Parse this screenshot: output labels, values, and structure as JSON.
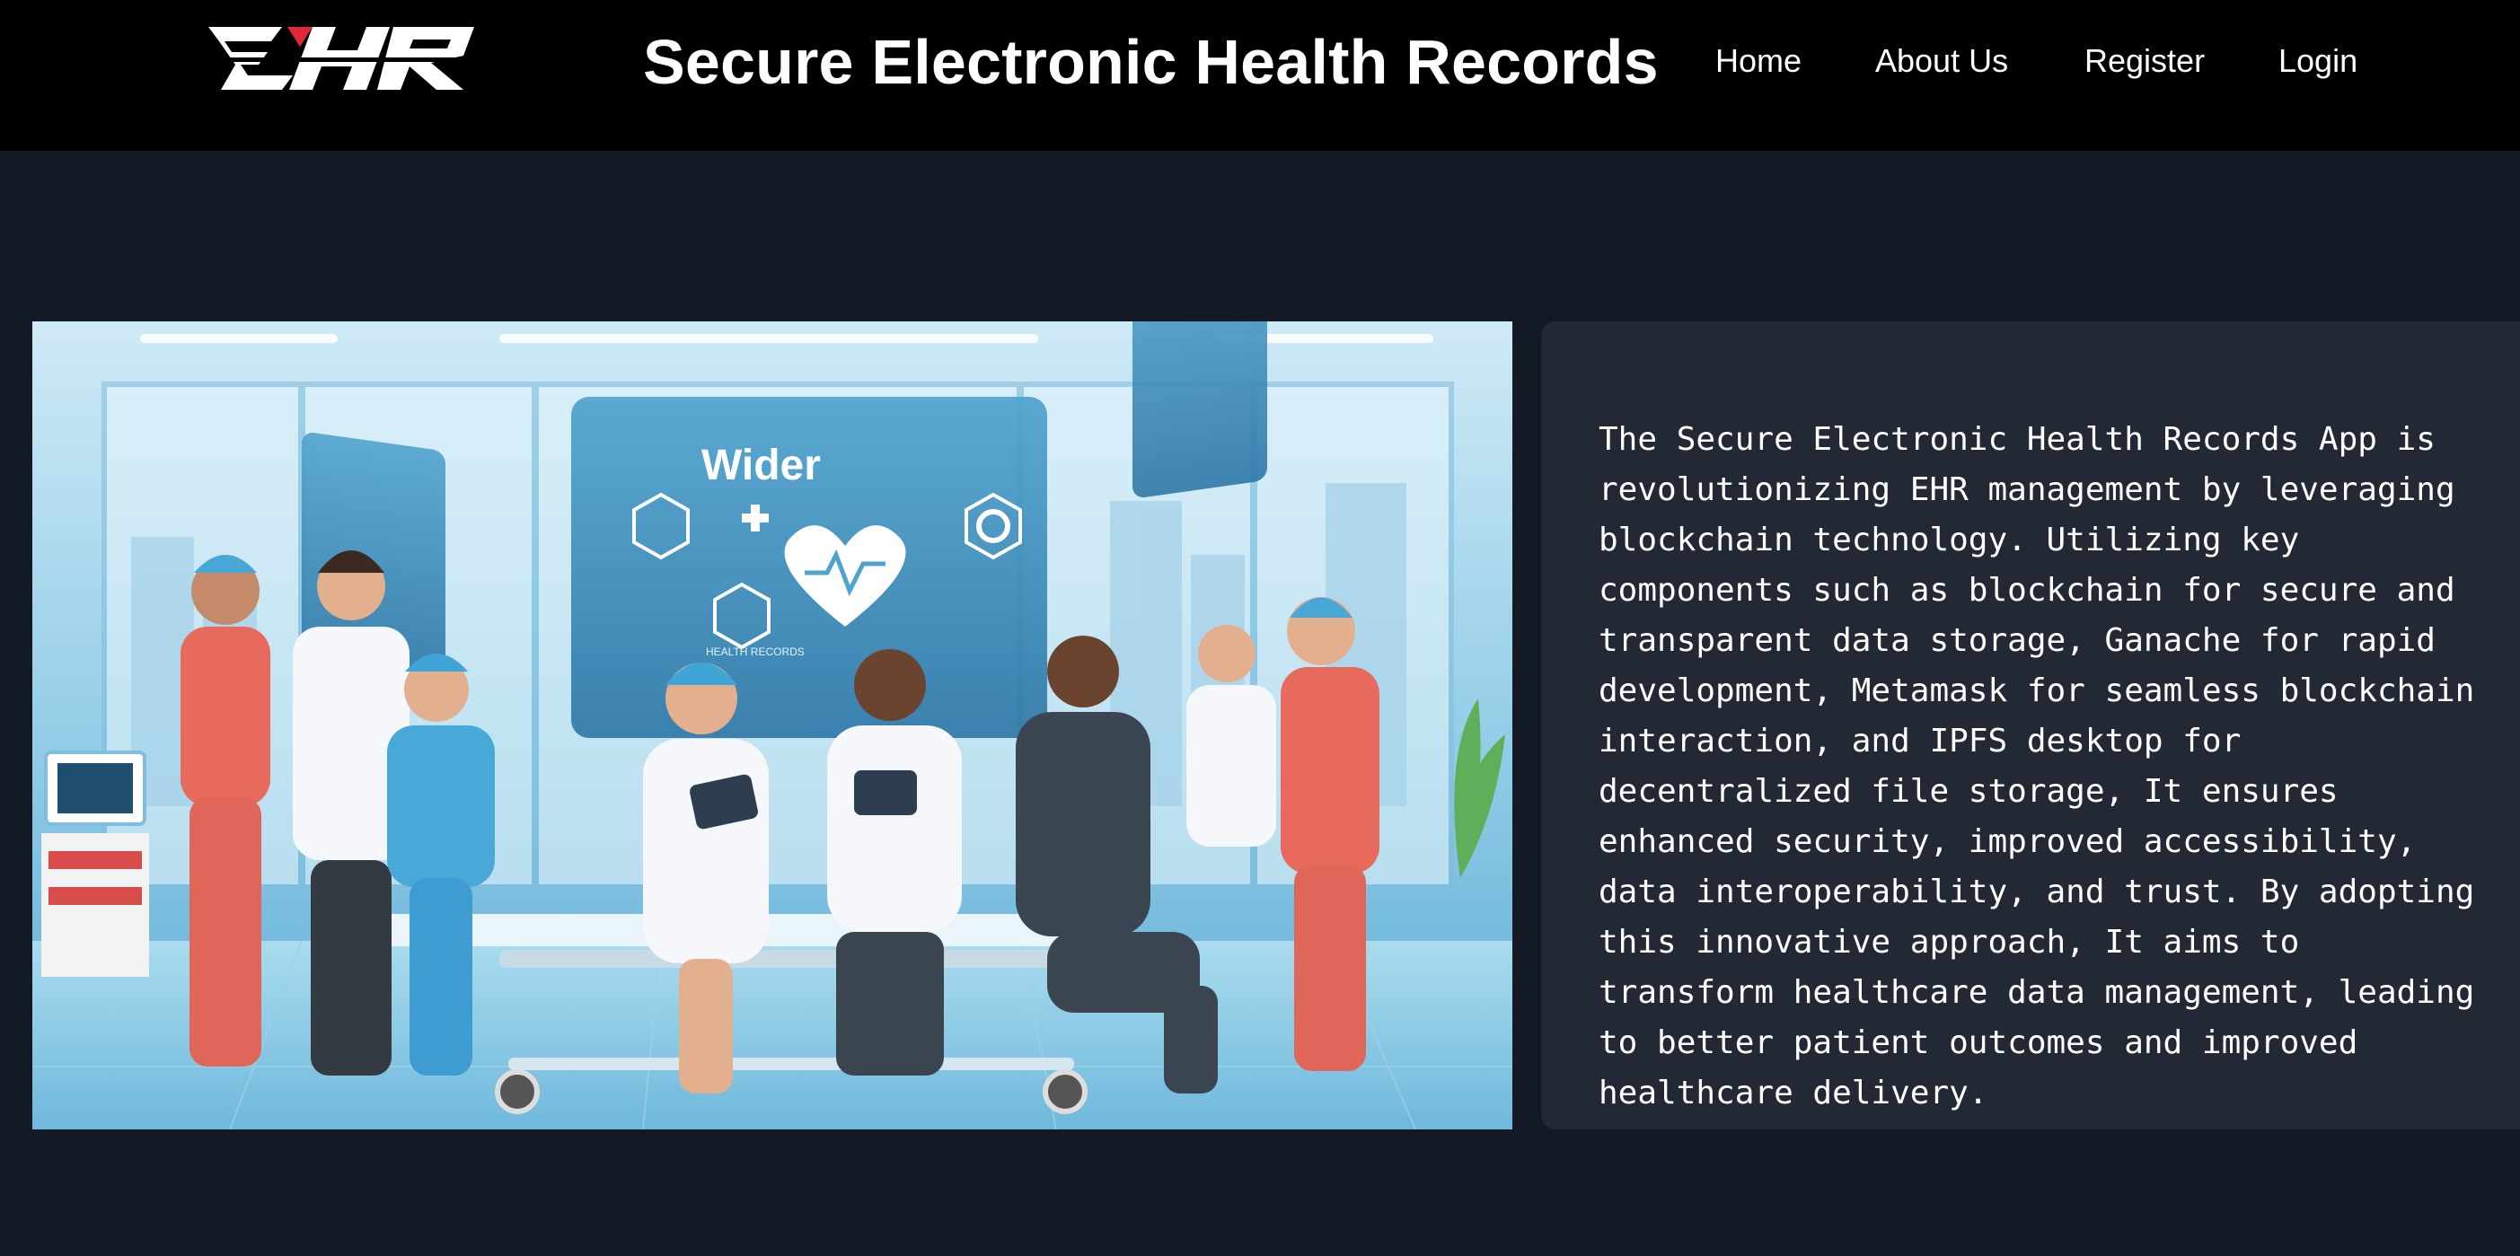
{
  "header": {
    "logo_text": "EHR",
    "title": "Secure Electronic Health Records",
    "nav": [
      {
        "label": "Home"
      },
      {
        "label": "About Us"
      },
      {
        "label": "Register"
      },
      {
        "label": "Login"
      }
    ]
  },
  "hero": {
    "screen_text": "Wider",
    "screen_subtext": "HEALTH RECORDS"
  },
  "about": {
    "paragraph": "The Secure Electronic Health Records App is\nrevolutionizing EHR management by leveraging\nblockchain technology. Utilizing key\ncomponents such as blockchain for secure and\ntransparent data storage, Ganache for rapid\ndevelopment, Metamask for seamless blockchain\ninteraction, and IPFS desktop for\ndecentralized file storage, It ensures\nenhanced security, improved accessibility,\ndata interoperability, and trust. By adopting\nthis innovative approach, It aims to\ntransform healthcare data management, leading\nto better patient outcomes and improved\nhealthcare delivery."
  },
  "colors": {
    "page_bg": "#131a26",
    "header_bg": "#000000",
    "panel_bg": "#222834",
    "logo_accent": "#e0283a"
  }
}
